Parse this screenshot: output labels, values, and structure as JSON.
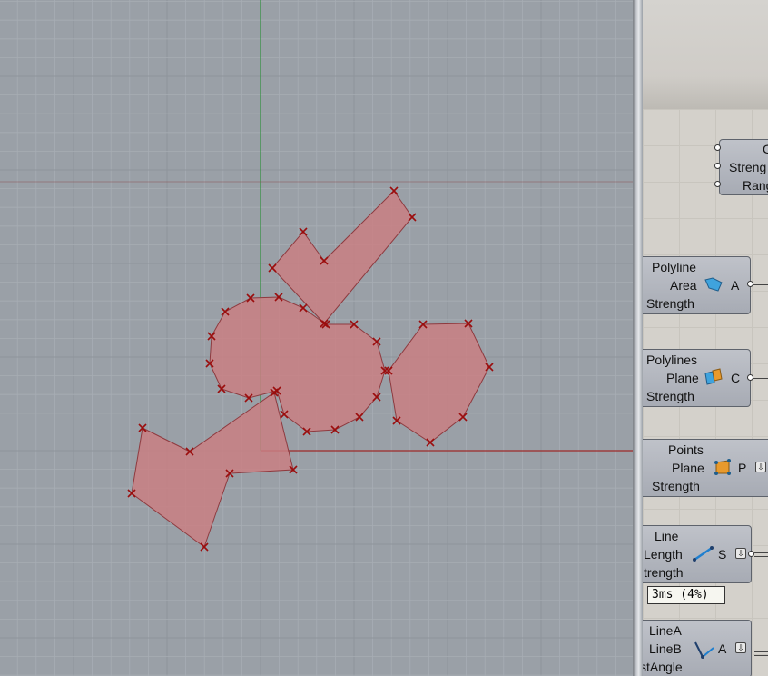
{
  "colors": {
    "viewport_bg": "#9aa0a7",
    "grid_minor": "#a7adb4",
    "grid_major": "#8e949b",
    "axis_x": "#9e2a2a",
    "axis_y": "#2f8f3c",
    "shape_fill": "#c97f82",
    "shape_stroke": "#8e3a3f",
    "point_marker": "#9b0d0d"
  },
  "components": {
    "top_partial": {
      "inputs": [
        "C",
        "Streng",
        "Rang"
      ]
    },
    "polyline": {
      "inputs": [
        "Polyline",
        "Area",
        "Strength"
      ],
      "output": "A",
      "icon": "polyline-area-icon"
    },
    "polylines": {
      "inputs": [
        "Polylines",
        "Plane",
        "Strength"
      ],
      "output": "C",
      "icon": "coplanar-icon"
    },
    "points": {
      "inputs": [
        "Points",
        "Plane",
        "Strength"
      ],
      "output": "P",
      "icon": "points-plane-icon"
    },
    "line": {
      "inputs": [
        "Line",
        "Length",
        "trength"
      ],
      "output": "S",
      "icon": "line-length-icon"
    },
    "angle": {
      "inputs": [
        "LineA",
        "LineB",
        "stAngle"
      ],
      "output": "A",
      "icon": "angle-icon"
    }
  },
  "tooltip": {
    "text": "3ms (4%)"
  },
  "expand_glyph": "⇩"
}
